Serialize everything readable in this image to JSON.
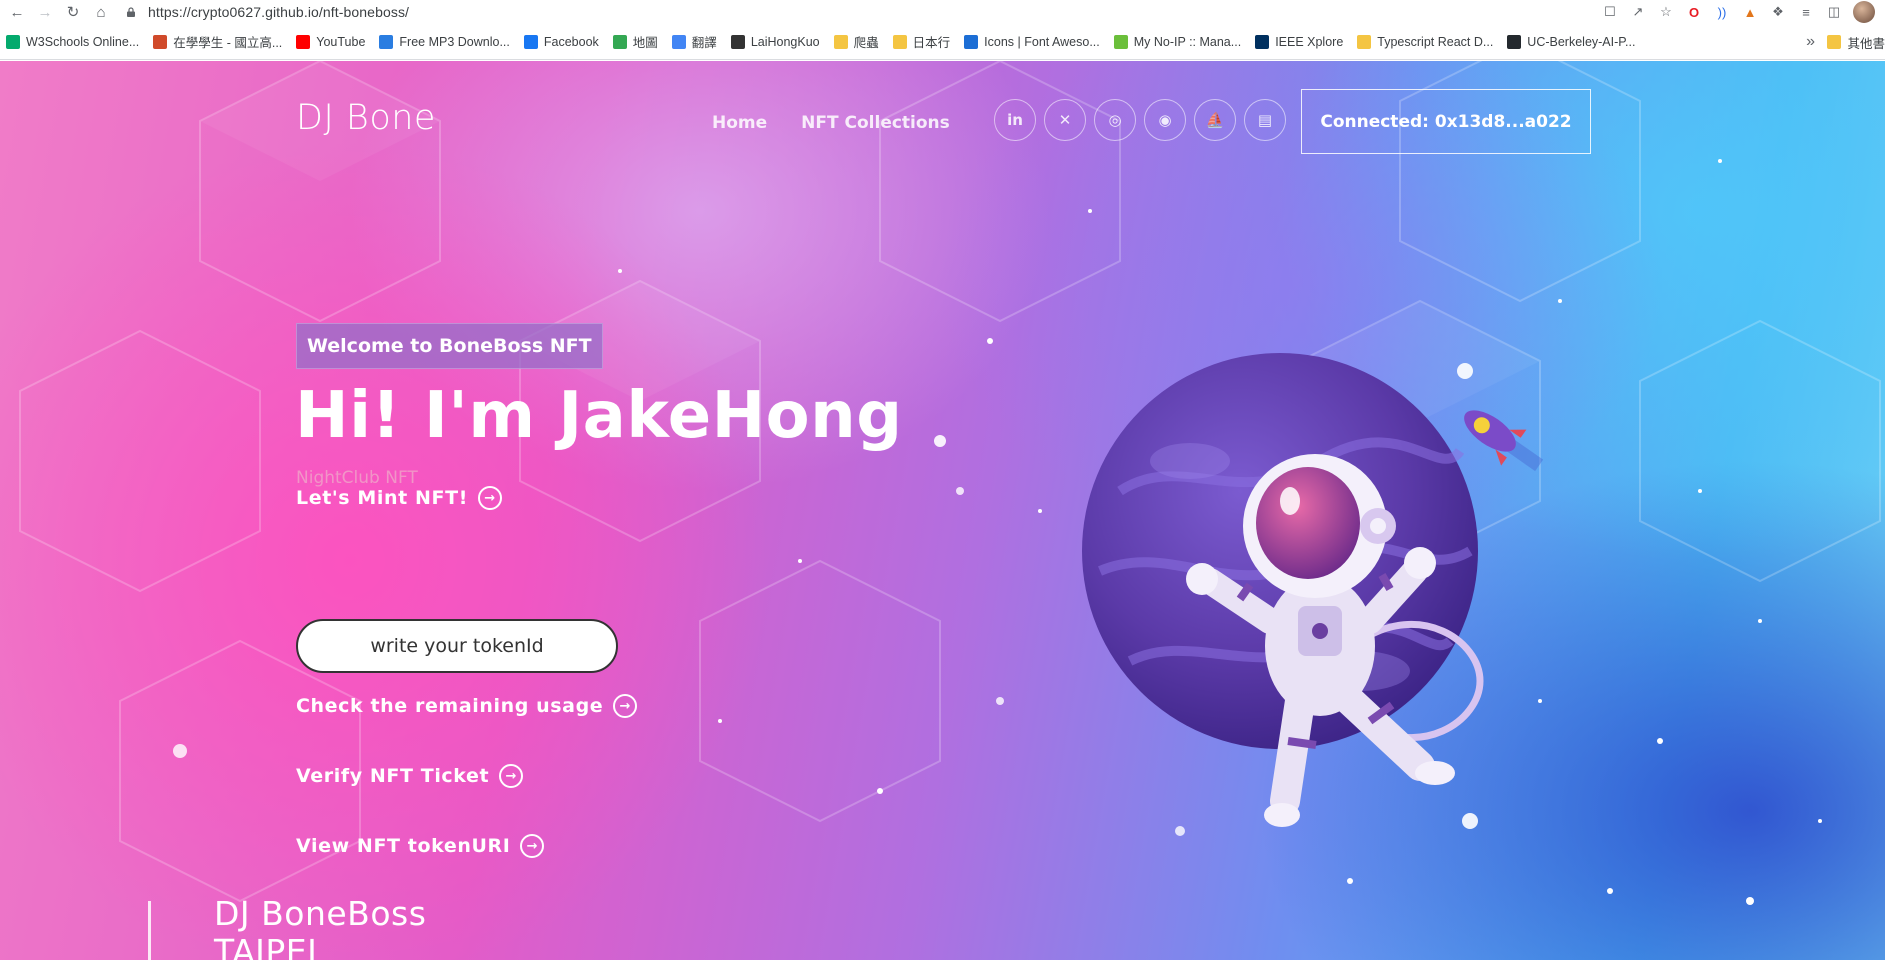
{
  "browser": {
    "url": "https://crypto0627.github.io/nft-boneboss/",
    "bookmarks": [
      {
        "label": "W3Schools Online...",
        "icon": "w3schools-icon",
        "color": "#04aa6d"
      },
      {
        "label": "在學學生 - 國立高...",
        "icon": "school-icon",
        "color": "#d04a2a"
      },
      {
        "label": "YouTube",
        "icon": "youtube-icon",
        "color": "#ff0000"
      },
      {
        "label": "Free MP3 Downlo...",
        "icon": "headphones-icon",
        "color": "#2a7de1"
      },
      {
        "label": "Facebook",
        "icon": "facebook-icon",
        "color": "#1877f2"
      },
      {
        "label": "地圖",
        "icon": "maps-icon",
        "color": "#34a853"
      },
      {
        "label": "翻譯",
        "icon": "translate-icon",
        "color": "#4285f4"
      },
      {
        "label": "LaiHongKuo",
        "icon": "globe-icon",
        "color": "#333333"
      },
      {
        "label": "爬蟲",
        "icon": "folder-icon",
        "color": "#f4c542"
      },
      {
        "label": "日本行",
        "icon": "folder-icon",
        "color": "#f4c542"
      },
      {
        "label": "Icons | Font Aweso...",
        "icon": "flag-icon",
        "color": "#1c6ed5"
      },
      {
        "label": "My No-IP :: Mana...",
        "icon": "noip-icon",
        "color": "#6bbf3b"
      },
      {
        "label": "IEEE Xplore",
        "icon": "ieee-icon",
        "color": "#00305f"
      },
      {
        "label": "Typescript React D...",
        "icon": "folder-icon",
        "color": "#f4c542"
      },
      {
        "label": "UC-Berkeley-AI-P...",
        "icon": "github-icon",
        "color": "#24292e"
      }
    ],
    "more_label": "»",
    "other_bookmarks": "其他書"
  },
  "nav": {
    "brand": "DJ Bone",
    "links": [
      "Home",
      "NFT Collections"
    ],
    "socials": [
      {
        "icon": "linkedin-icon",
        "glyph": "in"
      },
      {
        "icon": "twitter-icon",
        "glyph": "✕"
      },
      {
        "icon": "instagram-icon",
        "glyph": "◎"
      },
      {
        "icon": "github-icon",
        "glyph": "◉"
      },
      {
        "icon": "opensea-icon",
        "glyph": "⛵"
      },
      {
        "icon": "document-icon",
        "glyph": "▤"
      }
    ],
    "connect_label": "Connected: 0x13d8...a022"
  },
  "hero": {
    "badge": "Welcome to BoneBoss NFT",
    "title": "Hi! I'm JakeHong",
    "subtitle": "NightClub NFT",
    "mint_label": "Let's Mint NFT!",
    "token_placeholder": "write your tokenId",
    "check_label": "Check the remaining usage",
    "verify_label": "Verify NFT Ticket",
    "view_label": "View NFT tokenURI"
  },
  "footer_section": {
    "title_line1": "DJ BoneBoss",
    "title_line2": "TAIPEI"
  },
  "colors": {
    "accent_pink": "#e35cc8",
    "accent_blue": "#4cb9f3",
    "planet_purple": "#5b3aa8"
  }
}
